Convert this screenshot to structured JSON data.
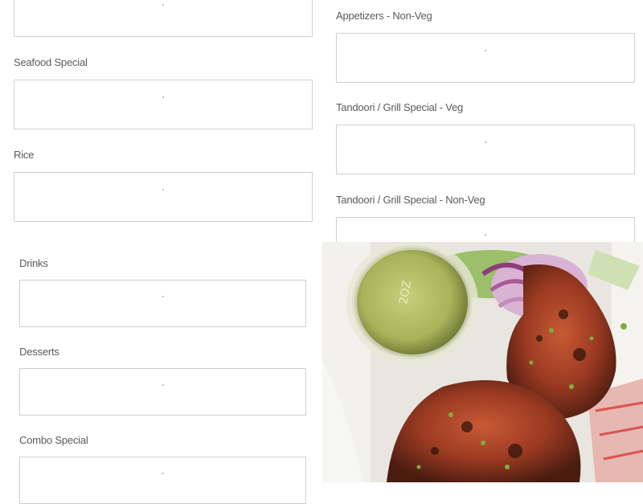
{
  "sections": [
    {
      "name": "top-partial",
      "label": "",
      "arrow": "ˊ"
    },
    {
      "name": "seafood-special",
      "label": "Seafood Special",
      "arrow": "ˊ"
    },
    {
      "name": "rice",
      "label": "Rice",
      "arrow": "ˊ"
    },
    {
      "name": "appetizers-non-veg",
      "label": "Appetizers - Non-Veg",
      "arrow": "ˊ"
    },
    {
      "name": "tandoori-grill-veg",
      "label": "Tandoori / Grill Special - Veg",
      "arrow": "ˊ"
    },
    {
      "name": "tandoori-grill-non-veg",
      "label": "Tandoori / Grill Special - Non-Veg",
      "arrow": "ˊ"
    },
    {
      "name": "drinks",
      "label": "Drinks",
      "arrow": "ˊ"
    },
    {
      "name": "desserts",
      "label": "Desserts",
      "arrow": "ˊ"
    },
    {
      "name": "combo-special",
      "label": "Combo Special",
      "arrow": "ˊ"
    }
  ],
  "photo": {
    "subject": "tandoori chicken with green chutney cup"
  },
  "colors": {
    "border": "#d0d0d0",
    "label": "#5a5a5a",
    "background": "#ffffff"
  }
}
